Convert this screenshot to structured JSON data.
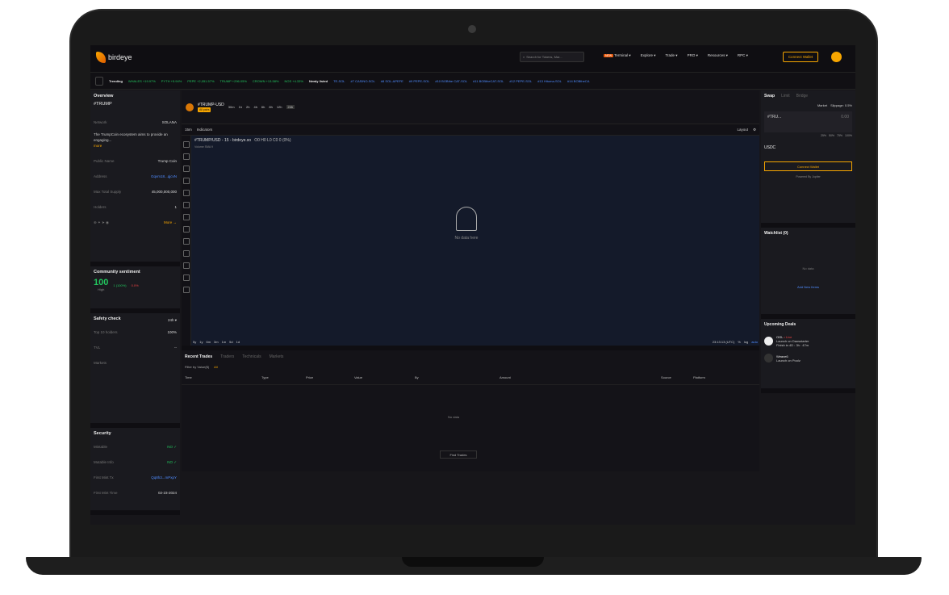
{
  "topnav": {
    "brand": "birdeye",
    "search_placeholder": "Search for Tokens, Mar...",
    "hot_badge": "NEW",
    "nav_items": [
      "Terminal ▾",
      "Explore ▾",
      "Trade ▾",
      "PRO ▾",
      "Resources ▾",
      "RPC ▾"
    ],
    "connect_label": "Connect Wallet"
  },
  "ticker": {
    "trending_label": "Trending",
    "items": [
      "WHALES +19.97%",
      "PYTH +5.94%",
      "PEPE +2,051.57%",
      "TRUMP +296.05%",
      "CROWN +13.58%",
      "NOS +4.33%"
    ],
    "newly_listed_label": "Newly listed",
    "listed": [
      "TE-SOL",
      "#7 CASINO-SOL",
      "#8 SOL-APEFE",
      "#9 PEPE-SOL",
      "#10 BOBthe CAT-SOL",
      "#11 BOBtheCAT-SOL",
      "#12 PEPE-SOL",
      "#13 Hitoma-SOL",
      "#14 BOBtheCA"
    ]
  },
  "overview": {
    "title": "Overview",
    "token": "#TRUMP",
    "network_label": "Network",
    "network_value": "SOLANA",
    "description": "The TrumpCoin ecosystem aims to provide an engaging...",
    "more": "more",
    "rows": [
      {
        "label": "Public Name",
        "value": "Trump Coin"
      },
      {
        "label": "Address",
        "value": "Gqvm18...qjcvN"
      },
      {
        "label": "Max Total Supply",
        "value": "45,000,000,000"
      },
      {
        "label": "Holders",
        "value": "1"
      }
    ],
    "more_link": "More →"
  },
  "sentiment": {
    "title": "Community sentiment",
    "score": "100",
    "level": "High",
    "up_pct": "1 (100%)",
    "down_pct": "0.0%"
  },
  "safety": {
    "title": "Safety check",
    "range": "24h ▾",
    "rows": [
      {
        "label": "Top 10 holders",
        "value": "100%"
      },
      {
        "label": "TVL",
        "value": "--"
      },
      {
        "label": "Markets",
        "value": ""
      }
    ]
  },
  "security": {
    "title": "Security",
    "rows": [
      {
        "label": "Mintable",
        "value": "NO ✓"
      },
      {
        "label": "Mutable Info",
        "value": "NO ✓"
      },
      {
        "label": "First Mint Tx",
        "value": "Qq8h3...mPxpY"
      },
      {
        "label": "First Mint Time",
        "value": "02-23-2024"
      }
    ]
  },
  "pair": {
    "name": "#TRUMP-USD",
    "all_pairs": "All pairs",
    "timeframes": [
      "30m",
      "1h",
      "2h",
      "4h",
      "6h",
      "8h",
      "12h",
      "24h"
    ],
    "selected_tf": "24h"
  },
  "chart": {
    "interval": "15m",
    "indicators": "Indicators",
    "layout": "Layout",
    "title": "#TRUMP/USD - 15 - birdeye.so",
    "ohlc": "O0 H0 L0 C0 0 (0%)",
    "volume": "Volume SMA 9",
    "no_data": "No data here",
    "ranges": [
      "5y",
      "1y",
      "6m",
      "3m",
      "1m",
      "5d",
      "1d"
    ],
    "time": "23:13:13 (UTC)",
    "pct": "%",
    "log": "log",
    "auto": "auto"
  },
  "trades": {
    "tabs": [
      "Recent Trades",
      "Traders",
      "Technicals",
      "Markets"
    ],
    "filter_label": "Filter by Value($)",
    "filter_all": "All",
    "columns": [
      "Time",
      "Type",
      "Price",
      "Value",
      "By",
      "Amount",
      "Source",
      "Platform"
    ],
    "empty": "No data",
    "find": "Find Trades"
  },
  "swap": {
    "tabs": [
      "Swap",
      "Limit",
      "Bridge"
    ],
    "market": "Market",
    "slippage": "Slippage: 0.5%",
    "from_token": "#TRU...",
    "from_amount": "0.00",
    "pcts": [
      "25%",
      "50%",
      "75%",
      "100%"
    ],
    "to_token": "USDC",
    "connect": "Connect Wallet",
    "powered": "Powered By",
    "powered_by": "Jupiter"
  },
  "watchlist": {
    "title": "Watchlist (0)",
    "empty": "No data",
    "add": "Add New Items"
  },
  "deals": {
    "title": "Upcoming Deals",
    "items": [
      {
        "name": "OGL",
        "badge": "• Live",
        "launch": "Launch on",
        "platform": "Daosstarter",
        "finish": "Finish in 4D : 3h : 47m"
      },
      {
        "name": "Weave6",
        "badge": "",
        "launch": "Launch on",
        "platform": "Poolz",
        "finish": ""
      }
    ]
  },
  "colors": {
    "accent": "#f7a600",
    "green": "#22c55e",
    "link": "#4f8cff",
    "bg": "#17161a"
  }
}
